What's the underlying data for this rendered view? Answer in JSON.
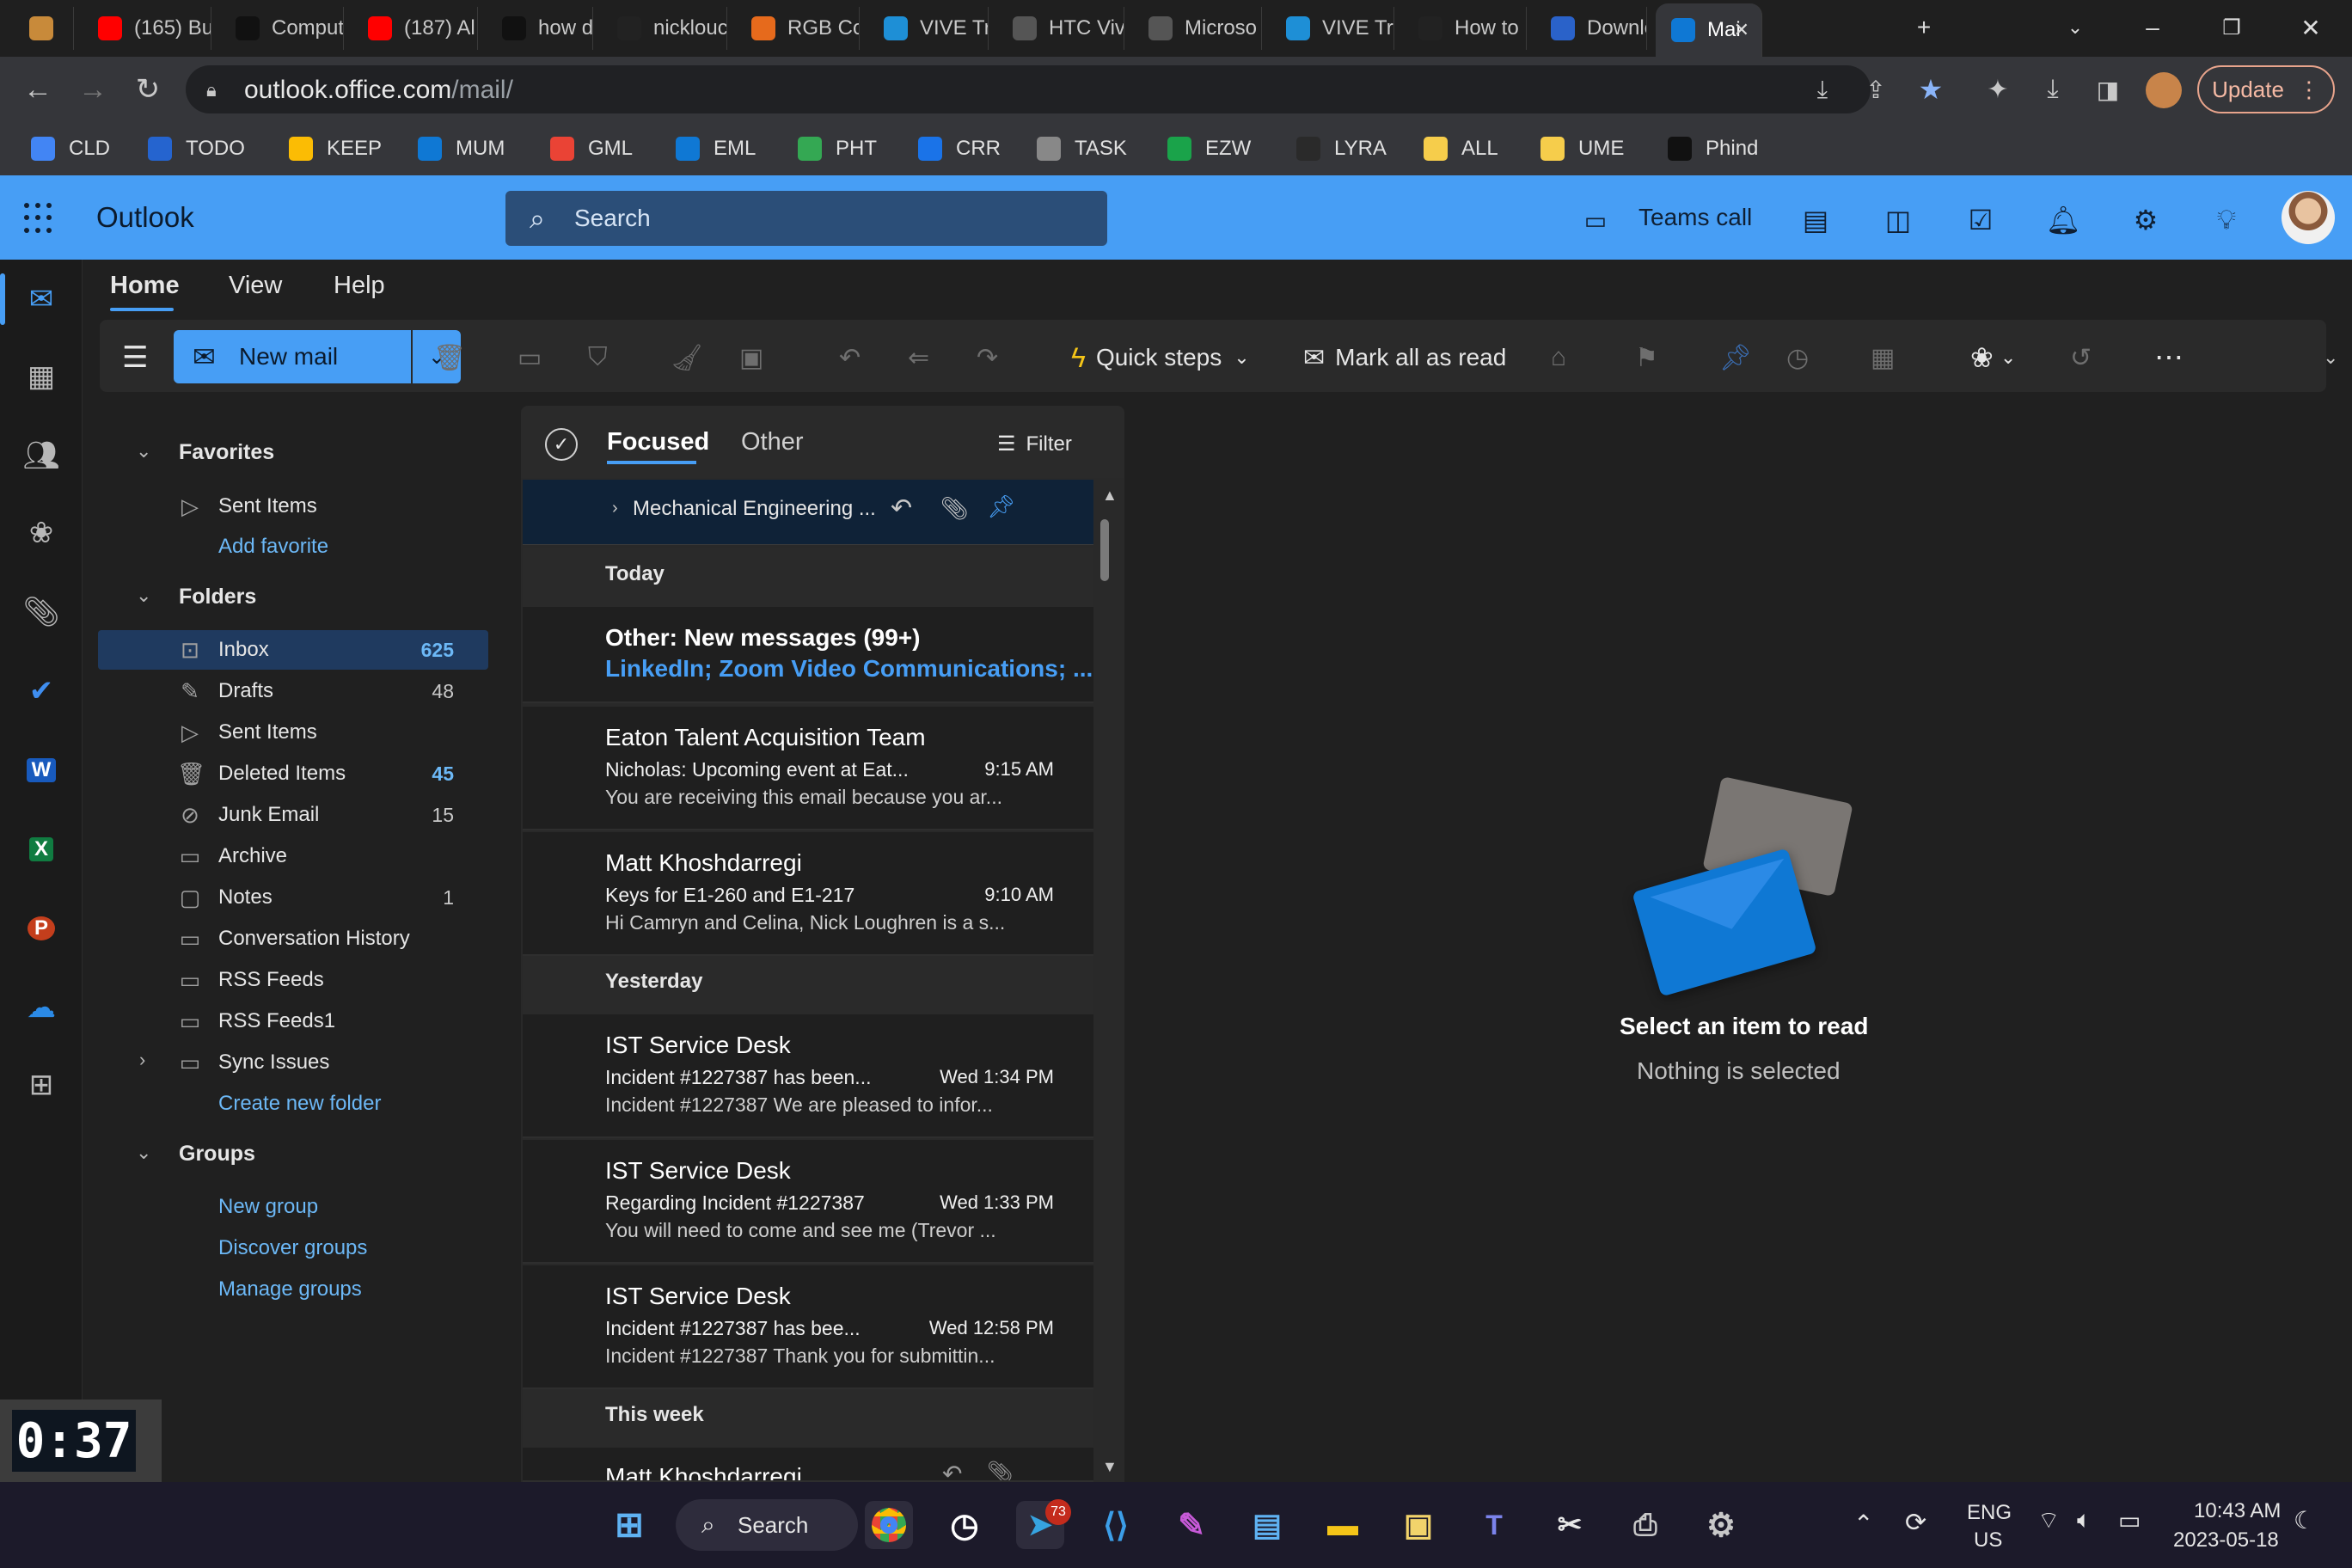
{
  "browser": {
    "tabs": [
      {
        "label": "",
        "icon": "profile-icon",
        "color": "#c88a3a"
      },
      {
        "label": "(165) Bu",
        "icon": "youtube-icon",
        "color": "#ff0000"
      },
      {
        "label": "Comput",
        "icon": "arrow-app-icon",
        "color": "#111111"
      },
      {
        "label": "(187) Al",
        "icon": "youtube-icon",
        "color": "#ff0000"
      },
      {
        "label": "how do",
        "icon": "phind-icon",
        "color": "#111111"
      },
      {
        "label": "nicklouc",
        "icon": "github-icon",
        "color": "#222222"
      },
      {
        "label": "RGB Co",
        "icon": "r-icon",
        "color": "#e66a1c"
      },
      {
        "label": "VIVE Tra",
        "icon": "vive-icon",
        "color": "#1e8fd6"
      },
      {
        "label": "HTC Viv",
        "icon": "globe-icon",
        "color": "#555555"
      },
      {
        "label": "Microso",
        "icon": "globe-icon",
        "color": "#555555"
      },
      {
        "label": "VIVE Tra",
        "icon": "vive-icon",
        "color": "#1e8fd6"
      },
      {
        "label": "How to",
        "icon": "github-icon",
        "color": "#222222"
      },
      {
        "label": "Downlo",
        "icon": "download-icon",
        "color": "#2a62c9"
      },
      {
        "label": "Mai",
        "icon": "outlook-icon",
        "color": "#0f78d4"
      }
    ],
    "url_host": "outlook.office.com",
    "url_path": "/mail/",
    "update_label": "Update",
    "bookmarks": [
      {
        "label": "CLD",
        "color": "#4285f4"
      },
      {
        "label": "TODO",
        "color": "#2564cf"
      },
      {
        "label": "KEEP",
        "color": "#fbbc04"
      },
      {
        "label": "MUM",
        "color": "#0f78d4"
      },
      {
        "label": "GML",
        "color": "#ea4335"
      },
      {
        "label": "EML",
        "color": "#0f78d4"
      },
      {
        "label": "PHT",
        "color": "#34a853"
      },
      {
        "label": "CRR",
        "color": "#1a73e8"
      },
      {
        "label": "TASK",
        "color": "#888888"
      },
      {
        "label": "EZW",
        "color": "#1aa34a"
      },
      {
        "label": "LYRA",
        "color": "#2a2a2a"
      },
      {
        "label": "ALL",
        "color": "#f6cd4b"
      },
      {
        "label": "UME",
        "color": "#f6cd4b"
      },
      {
        "label": "Phind",
        "color": "#111111"
      }
    ]
  },
  "outlook": {
    "brand": "Outlook",
    "search_placeholder": "Search",
    "teams_call": "Teams call",
    "ribbon_tabs": [
      "Home",
      "View",
      "Help"
    ],
    "new_mail": "New mail",
    "quick_steps": "Quick steps",
    "mark_all_read": "Mark all as read"
  },
  "folders": {
    "favorites_header": "Favorites",
    "favorites": [
      {
        "label": "Sent Items"
      }
    ],
    "add_favorite": "Add favorite",
    "folders_header": "Folders",
    "items": [
      {
        "label": "Inbox",
        "count": "625",
        "icon": "inbox-icon"
      },
      {
        "label": "Drafts",
        "count": "48",
        "icon": "drafts-icon"
      },
      {
        "label": "Sent Items",
        "count": "",
        "icon": "sent-icon"
      },
      {
        "label": "Deleted Items",
        "count": "45",
        "icon": "trash-icon"
      },
      {
        "label": "Junk Email",
        "count": "15",
        "icon": "junk-icon"
      },
      {
        "label": "Archive",
        "count": "",
        "icon": "archive-icon"
      },
      {
        "label": "Notes",
        "count": "1",
        "icon": "notes-icon"
      },
      {
        "label": "Conversation History",
        "count": "",
        "icon": "folder-icon"
      },
      {
        "label": "RSS Feeds",
        "count": "",
        "icon": "folder-icon"
      },
      {
        "label": "RSS Feeds1",
        "count": "",
        "icon": "folder-icon"
      },
      {
        "label": "Sync Issues",
        "count": "",
        "icon": "folder-icon"
      }
    ],
    "create_new_folder": "Create new folder",
    "groups_header": "Groups",
    "group_links": [
      "New group",
      "Discover groups",
      "Manage groups"
    ]
  },
  "mail_list": {
    "tabs": [
      "Focused",
      "Other"
    ],
    "filter": "Filter",
    "pinned_subject": "Mechanical Engineering ...",
    "today": "Today",
    "other_title": "Other: New messages (99+)",
    "other_senders": "LinkedIn; Zoom Video Communications; ...",
    "yesterday": "Yesterday",
    "this_week": "This week",
    "messages": [
      {
        "from": "Eaton Talent Acquisition Team",
        "subject": "Nicholas: Upcoming event at Eat...",
        "time": "9:15 AM",
        "preview": "You are receiving this email because you ar..."
      },
      {
        "from": "Matt Khoshdarregi",
        "subject": "Keys for E1-260 and E1-217",
        "time": "9:10 AM",
        "preview": "Hi Camryn and Celina, Nick Loughren is a s..."
      },
      {
        "from": "IST Service Desk",
        "subject": "Incident #1227387 has been...",
        "time": "Wed 1:34 PM",
        "preview": "Incident #1227387 We are pleased to infor..."
      },
      {
        "from": "IST Service Desk",
        "subject": "Regarding Incident #1227387",
        "time": "Wed 1:33 PM",
        "preview": "You will need to come and see me (Trevor ..."
      },
      {
        "from": "IST Service Desk",
        "subject": "Incident #1227387 has bee...",
        "time": "Wed 12:58 PM",
        "preview": "Incident #1227387 Thank you for submittin..."
      },
      {
        "from": "Matt Khoshdarregi",
        "subject": "",
        "time": "",
        "preview": ""
      }
    ]
  },
  "reading_pane": {
    "title": "Select an item to read",
    "subtitle": "Nothing is selected"
  },
  "timer": "0:37",
  "taskbar": {
    "search": "Search",
    "telegram_badge": "73",
    "lang": "ENG",
    "region": "US",
    "time": "10:43 AM",
    "date": "2023-05-18"
  }
}
